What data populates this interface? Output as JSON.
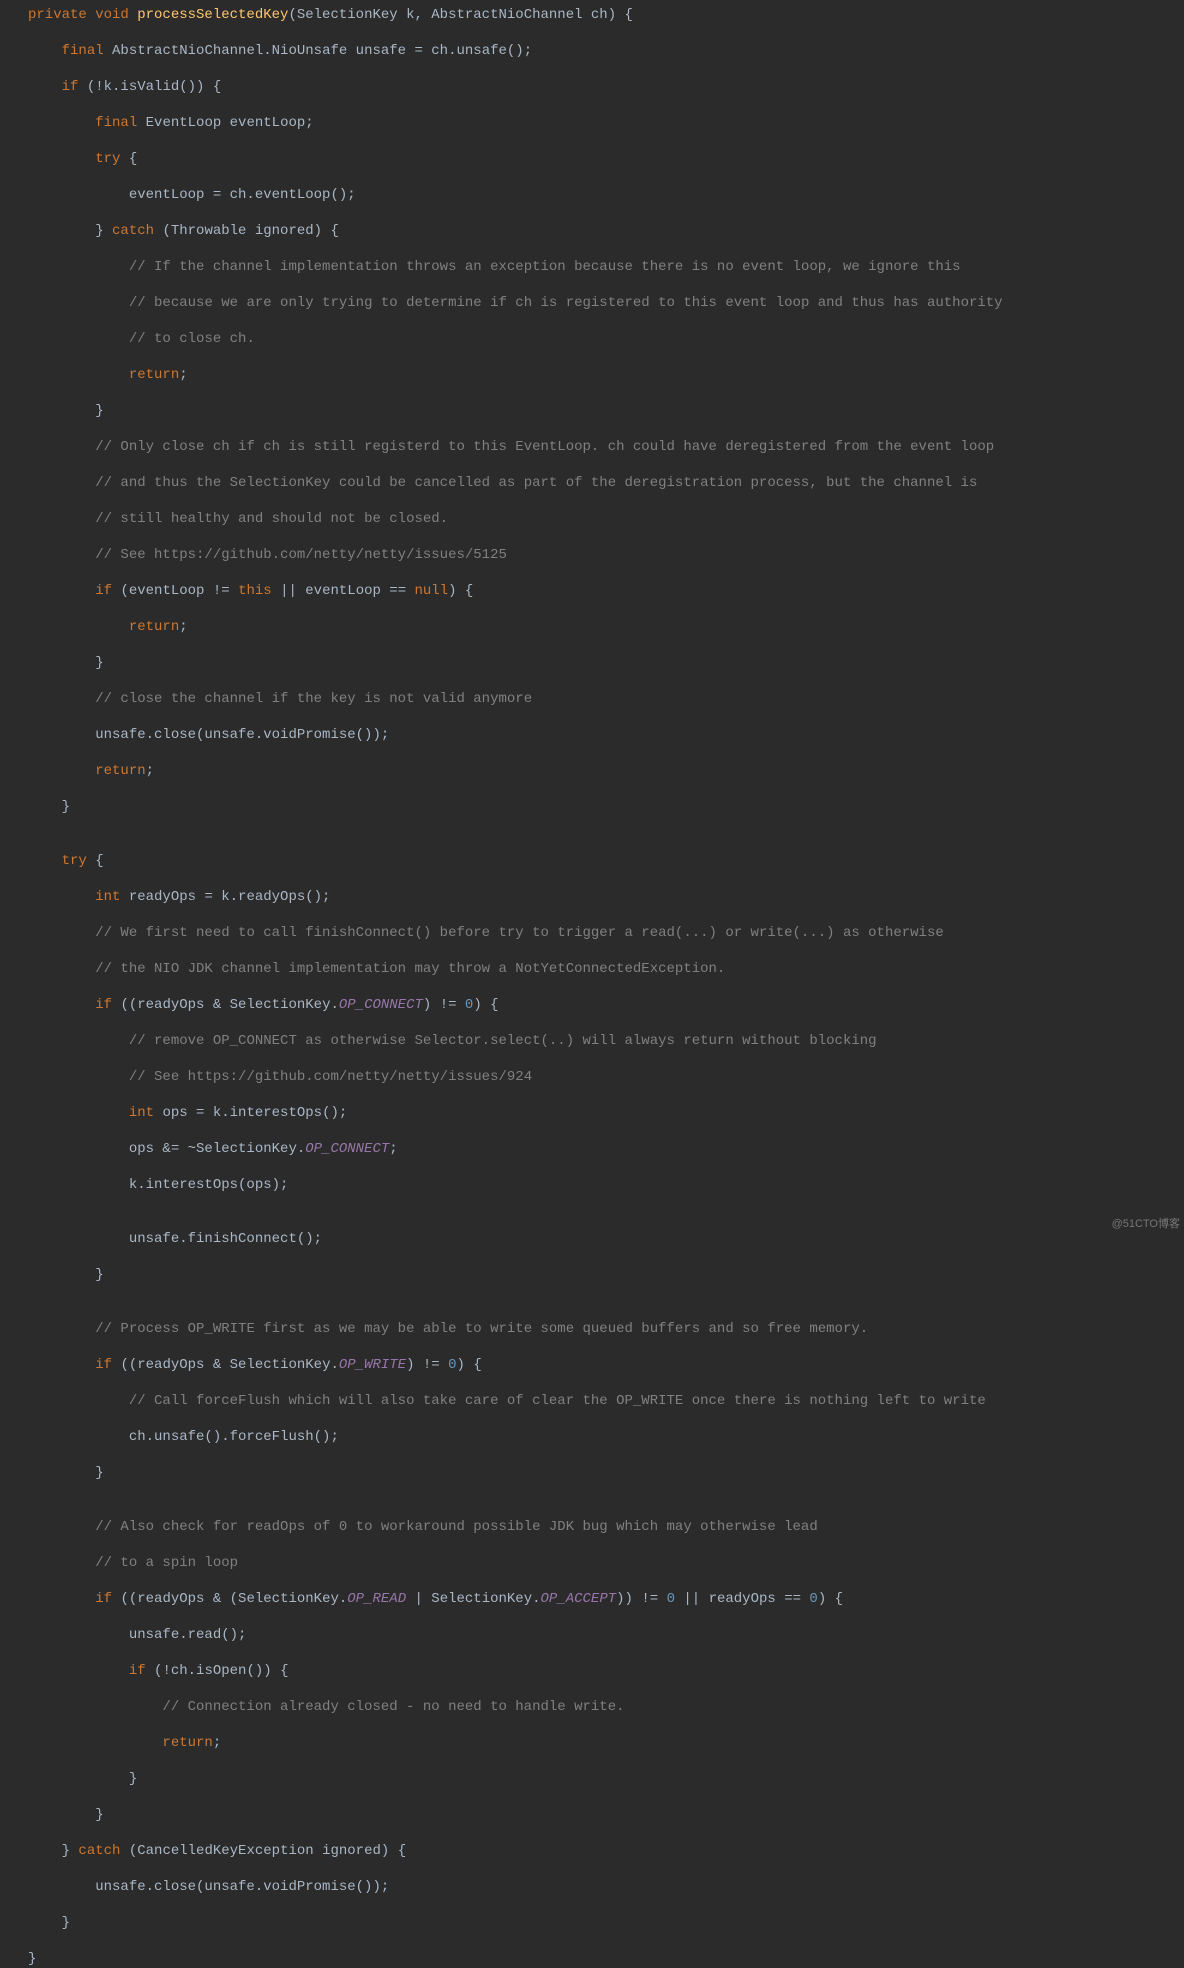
{
  "watermark": "@51CTO博客",
  "code": {
    "l01": {
      "a": "private void ",
      "b": "processSelectedKey",
      "c": "(SelectionKey k, AbstractNioChannel ch) {"
    },
    "l02": {
      "a": "    ",
      "b": "final ",
      "c": "AbstractNioChannel.NioUnsafe unsafe = ch.unsafe();"
    },
    "l03": {
      "a": "    ",
      "b": "if ",
      "c": "(!k.isValid()) {"
    },
    "l04": {
      "a": "        ",
      "b": "final ",
      "c": "EventLoop eventLoop;"
    },
    "l05": {
      "a": "        ",
      "b": "try ",
      "c": "{"
    },
    "l06": {
      "a": "            eventLoop = ch.eventLoop();"
    },
    "l07": {
      "a": "        } ",
      "b": "catch ",
      "c": "(Throwable ignored) {"
    },
    "l08": {
      "a": "            ",
      "b": "// If the channel implementation throws an exception because there is no event loop, we ignore this"
    },
    "l09": {
      "a": "            ",
      "b": "// because we are only trying to determine if ch is registered to this event loop and thus has authority"
    },
    "l10": {
      "a": "            ",
      "b": "// to close ch."
    },
    "l11": {
      "a": "            ",
      "b": "return",
      ";": ";"
    },
    "l12": {
      "a": "        }"
    },
    "l13": {
      "a": "        ",
      "b": "// Only close ch if ch is still registerd to this EventLoop. ch could have deregistered from the event loop"
    },
    "l14": {
      "a": "        ",
      "b": "// and thus the SelectionKey could be cancelled as part of the deregistration process, but the channel is"
    },
    "l15": {
      "a": "        ",
      "b": "// still healthy and should not be closed."
    },
    "l16": {
      "a": "        ",
      "b": "// See https://github.com/netty/netty/issues/5125"
    },
    "l17": {
      "a": "        ",
      "b": "if ",
      "c": "(eventLoop != ",
      "d": "this ",
      "e": "|| eventLoop == ",
      "f": "null",
      "g": ") {"
    },
    "l18": {
      "a": "            ",
      "b": "return",
      ";": ";"
    },
    "l19": {
      "a": "        }"
    },
    "l20": {
      "a": "        ",
      "b": "// close the channel if the key is not valid anymore"
    },
    "l21": {
      "a": "        unsafe.close(unsafe.voidPromise());"
    },
    "l22": {
      "a": "        ",
      "b": "return",
      ";": ";"
    },
    "l23": {
      "a": "    }"
    },
    "l24": {
      "a": ""
    },
    "l25": {
      "a": "    ",
      "b": "try ",
      "c": "{"
    },
    "l26": {
      "a": "        ",
      "b": "int ",
      "c": "readyOps = k.readyOps();"
    },
    "l27": {
      "a": "        ",
      "b": "// We first need to call finishConnect() before try to trigger a read(...) or write(...) as otherwise"
    },
    "l28": {
      "a": "        ",
      "b": "// the NIO JDK channel implementation may throw a NotYetConnectedException."
    },
    "l29": {
      "a": "        ",
      "b": "if ",
      "c": "((readyOps & SelectionKey.",
      "d": "OP_CONNECT",
      "e": ") != ",
      "f": "0",
      "g": ") {"
    },
    "l30": {
      "a": "            ",
      "b": "// remove OP_CONNECT as otherwise Selector.select(..) will always return without blocking"
    },
    "l31": {
      "a": "            ",
      "b": "// See https://github.com/netty/netty/issues/924"
    },
    "l32": {
      "a": "            ",
      "b": "int ",
      "c": "ops = k.interestOps();"
    },
    "l33": {
      "a": "            ops &= ~SelectionKey.",
      "b": "OP_CONNECT",
      "c": ";"
    },
    "l34": {
      "a": "            k.interestOps(ops);"
    },
    "l35": {
      "a": ""
    },
    "l36": {
      "a": "            unsafe.finishConnect();"
    },
    "l37": {
      "a": "        }"
    },
    "l38": {
      "a": ""
    },
    "l39": {
      "a": "        ",
      "b": "// Process OP_WRITE first as we may be able to write some queued buffers and so free memory."
    },
    "l40": {
      "a": "        ",
      "b": "if ",
      "c": "((readyOps & SelectionKey.",
      "d": "OP_WRITE",
      "e": ") != ",
      "f": "0",
      "g": ") {"
    },
    "l41": {
      "a": "            ",
      "b": "// Call forceFlush which will also take care of clear the OP_WRITE once there is nothing left to write"
    },
    "l42": {
      "a": "            ch.unsafe().forceFlush();"
    },
    "l43": {
      "a": "        }"
    },
    "l44": {
      "a": ""
    },
    "l45": {
      "a": "        ",
      "b": "// Also check for readOps of 0 to workaround possible JDK bug which may otherwise lead"
    },
    "l46": {
      "a": "        ",
      "b": "// to a spin loop"
    },
    "l47": {
      "a": "        ",
      "b": "if ",
      "c": "((readyOps & (SelectionKey.",
      "d": "OP_READ",
      "e": " | SelectionKey.",
      "f": "OP_ACCEPT",
      "g": ")) != ",
      "h": "0 ",
      "i": "|| readyOps == ",
      "j": "0",
      "k": ") {"
    },
    "l48": {
      "a": "            unsafe.read();"
    },
    "l49": {
      "a": "            ",
      "b": "if ",
      "c": "(!ch.isOpen()) {"
    },
    "l50": {
      "a": "                ",
      "b": "// Connection already closed - no need to handle write."
    },
    "l51": {
      "a": "                ",
      "b": "return",
      ";": ";"
    },
    "l52": {
      "a": "            }"
    },
    "l53": {
      "a": "        }"
    },
    "l54": {
      "a": "    } ",
      "b": "catch ",
      "c": "(CancelledKeyException ignored) {"
    },
    "l55": {
      "a": "        unsafe.close(unsafe.voidPromise());"
    },
    "l56": {
      "a": "    }"
    },
    "l57": {
      "a": "}"
    }
  }
}
